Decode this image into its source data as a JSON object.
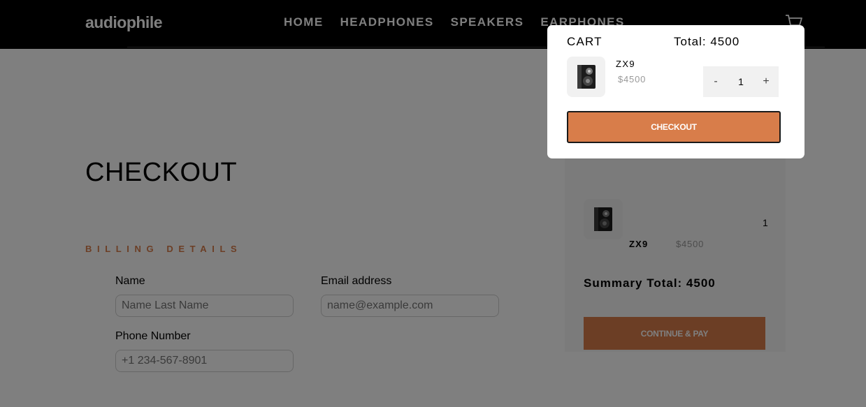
{
  "header": {
    "logo": "audiophile",
    "nav": [
      "HOME",
      "HEADPHONES",
      "SPEAKERS",
      "EARPHONES"
    ]
  },
  "checkout": {
    "title": "CHECKOUT",
    "billing_heading": "BILLING DETAILS",
    "fields": {
      "name": {
        "label": "Name",
        "placeholder": "Name Last Name",
        "value": ""
      },
      "email": {
        "label": "Email address",
        "placeholder": "name@example.com",
        "value": ""
      },
      "phone": {
        "label": "Phone Number",
        "placeholder": "+1 234-567-8901",
        "value": ""
      }
    }
  },
  "summary": {
    "item": {
      "name": "ZX9",
      "price": "$4500",
      "quantity": "1"
    },
    "total": "Summary Total: 4500",
    "pay_button": "CONTINUE & PAY"
  },
  "cart": {
    "title": "CART",
    "total": "Total: 4500",
    "item": {
      "name": "ZX9",
      "price": "$4500",
      "quantity": "1"
    },
    "minus": "-",
    "plus": "+",
    "checkout_button": "CHECKOUT"
  },
  "colors": {
    "accent": "#d87d4a",
    "header_bg": "#000000",
    "overlay": "rgba(0,0,0,0.5)"
  },
  "icons": {
    "cart": "cart-icon",
    "product": "speaker-icon"
  }
}
